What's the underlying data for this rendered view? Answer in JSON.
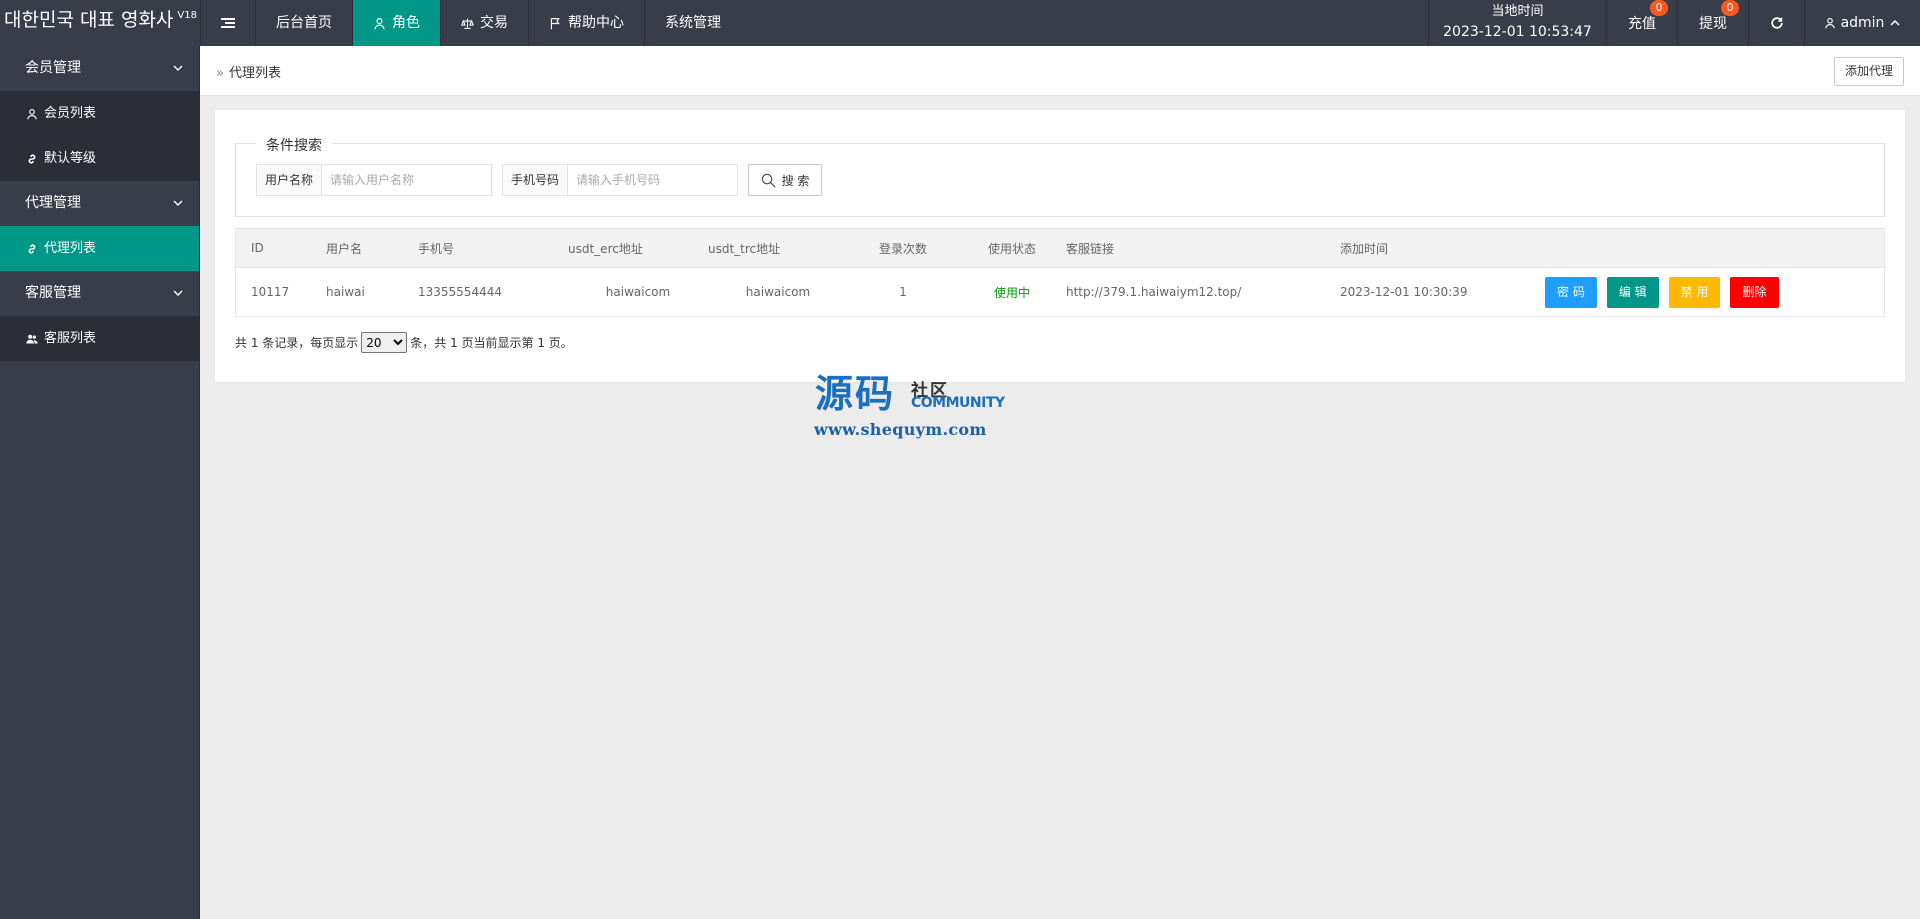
{
  "header": {
    "logo": "대한민국 대표 영화사",
    "version": "V18",
    "nav": [
      {
        "label": "后台首页",
        "icon": ""
      },
      {
        "label": "角色",
        "icon": "user-icon"
      },
      {
        "label": "交易",
        "icon": "scale-icon"
      },
      {
        "label": "帮助中心",
        "icon": "flag-icon"
      },
      {
        "label": "系统管理",
        "icon": ""
      }
    ],
    "active_nav": "角色",
    "clock_label": "当地时间",
    "clock_value": "2023-12-01 10:53:47",
    "recharge_label": "充值",
    "recharge_badge": "0",
    "withdraw_label": "提现",
    "withdraw_badge": "0",
    "admin_label": "admin"
  },
  "sidebar": {
    "groups": [
      {
        "label": "会员管理",
        "items": [
          {
            "label": "会员列表",
            "icon": "user-icon"
          },
          {
            "label": "默认等级",
            "icon": "link-icon"
          }
        ]
      },
      {
        "label": "代理管理",
        "items": [
          {
            "label": "代理列表",
            "icon": "link-icon",
            "active": true
          }
        ]
      },
      {
        "label": "客服管理",
        "items": [
          {
            "label": "客服列表",
            "icon": "users-icon"
          }
        ]
      }
    ]
  },
  "breadcrumb": {
    "separator": "»",
    "current": "代理列表",
    "add_button": "添加代理"
  },
  "search": {
    "legend": "条件搜索",
    "username_label": "用户名称",
    "username_placeholder": "请输入用户名称",
    "phone_label": "手机号码",
    "phone_placeholder": "请输入手机号码",
    "search_button": "搜 索"
  },
  "table": {
    "columns": [
      "ID",
      "用户名",
      "手机号",
      "usdt_erc地址",
      "usdt_trc地址",
      "登录次数",
      "使用状态",
      "客服链接",
      "添加时间"
    ],
    "rows": [
      {
        "id": "10117",
        "username": "haiwai",
        "phone": "13355554444",
        "erc": "haiwaicom",
        "trc": "haiwaicom",
        "login_count": "1",
        "status": "使用中",
        "link": "http://379.1.haiwaiym12.top/",
        "added": "2023-12-01 10:30:39",
        "actions": [
          "密 码",
          "编 辑",
          "禁 用",
          "删除"
        ]
      }
    ]
  },
  "pager": {
    "prefix": "共 1 条记录，每页显示",
    "page_size": "20",
    "suffix": "条，共 1 页当前显示第 1 页。"
  },
  "watermark": {
    "big": "源码",
    "cn": "社区",
    "en": "COMMUNITY",
    "url": "www.shequym.com"
  },
  "colors": {
    "header_bg": "#393d49",
    "accent": "#009688",
    "blue": "#1e9fff",
    "yellow": "#ffb800",
    "red": "#ff0000",
    "status_green": "#009f00"
  }
}
